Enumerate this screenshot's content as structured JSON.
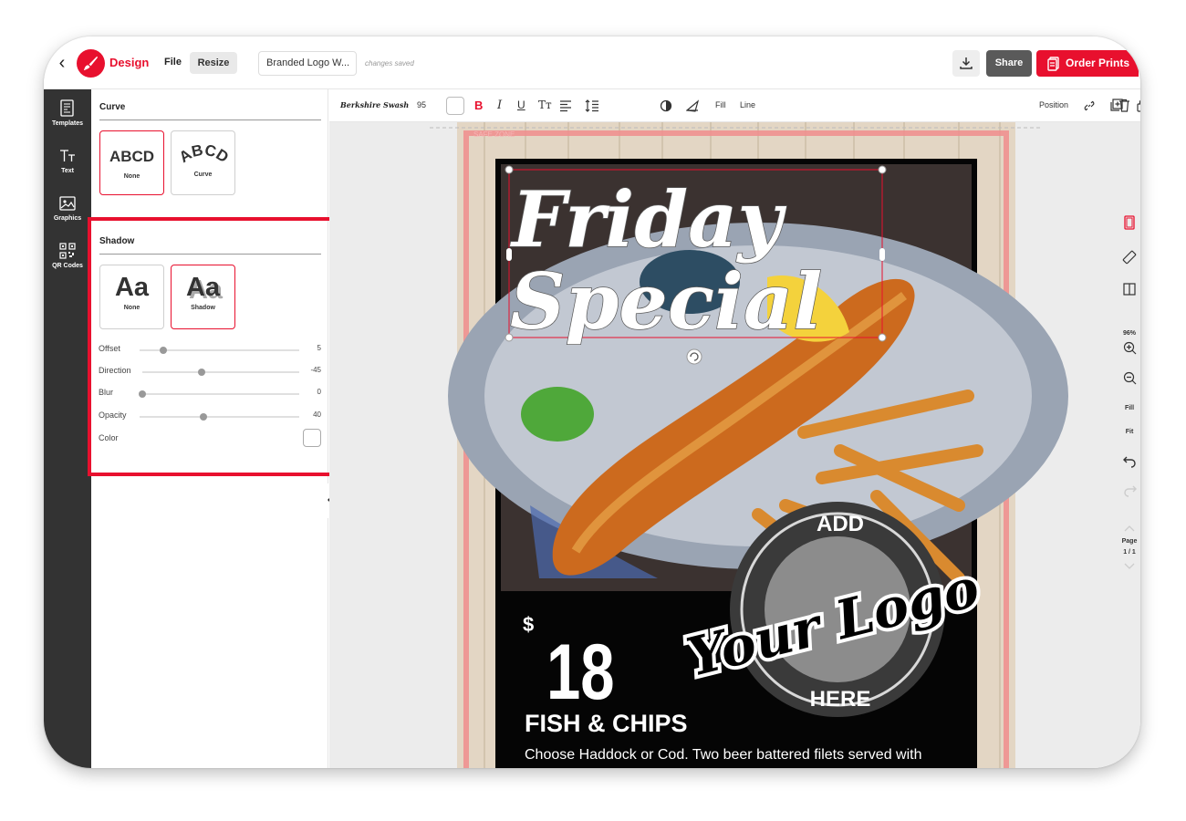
{
  "topbar": {
    "brand": "Design",
    "menu_file": "File",
    "menu_resize": "Resize",
    "doc_name": "Branded Logo W...",
    "saved_status": "changes saved",
    "share_label": "Share",
    "order_label": "Order Prints",
    "accent_color": "#e8102e"
  },
  "rail": {
    "items": [
      {
        "label": "Templates",
        "icon": "templates-icon"
      },
      {
        "label": "Text",
        "icon": "text-icon"
      },
      {
        "label": "Graphics",
        "icon": "graphics-icon"
      },
      {
        "label": "QR Codes",
        "icon": "qr-code-icon"
      }
    ]
  },
  "panel": {
    "curve": {
      "title": "Curve",
      "options": [
        {
          "sample": "ABCD",
          "caption": "None",
          "selected": true
        },
        {
          "sample": "ABCD",
          "caption": "Curve",
          "selected": false
        }
      ]
    },
    "shadow": {
      "title": "Shadow",
      "options": [
        {
          "sample": "Aa",
          "caption": "None",
          "selected": false
        },
        {
          "sample": "Aa",
          "caption": "Shadow",
          "selected": true
        }
      ],
      "sliders": [
        {
          "name": "Offset",
          "value": "5",
          "fraction": 0.15
        },
        {
          "name": "Direction",
          "value": "-45",
          "fraction": 0.38
        },
        {
          "name": "Blur",
          "value": "0",
          "fraction": 0.0
        },
        {
          "name": "Opacity",
          "value": "40",
          "fraction": 0.4
        }
      ],
      "color_label": "Color",
      "color_value": "#ffffff"
    }
  },
  "toolbar": {
    "font_name": "Berkshire Swash",
    "font_size": "95",
    "bold": "B",
    "italic": "I",
    "underline": "U",
    "case": "Tт",
    "fill_label": "Fill",
    "line_label": "Line",
    "position_label": "Position"
  },
  "canvas": {
    "safe_zone_label": "SAFE ZONE",
    "headline_1": "Friday",
    "headline_2": "Special",
    "currency": "$",
    "price": "18",
    "dish": "FISH & CHIPS",
    "description": "Choose Haddock or Cod. Two beer battered filets served with",
    "logo_top": "ADD",
    "logo_script": "Your Logo",
    "logo_bottom": "HERE"
  },
  "right_tools": {
    "zoom": "96%",
    "fill_label": "Fill",
    "fit_label": "Fit",
    "page_label": "Page",
    "page_count": "1 / 1"
  }
}
